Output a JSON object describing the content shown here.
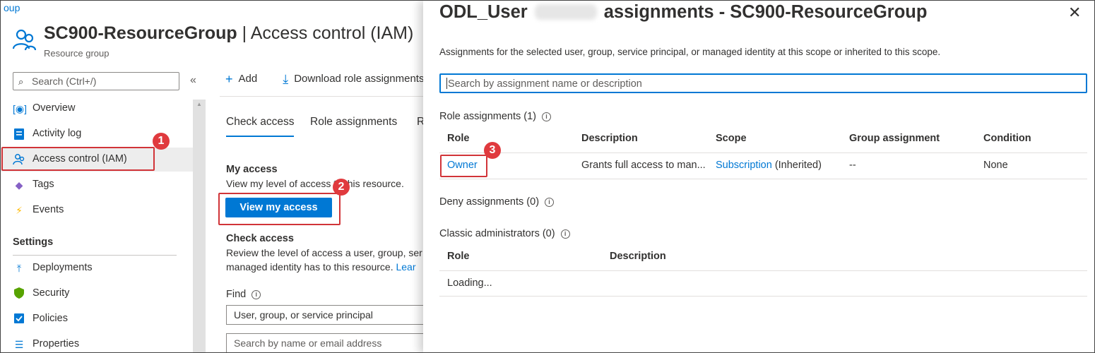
{
  "breadcrumb": {
    "tail": "oup"
  },
  "header": {
    "resource_name": "SC900-ResourceGroup",
    "separator": " | ",
    "page_name": "Access control (IAM)",
    "subtitle": "Resource group"
  },
  "sidebar": {
    "search_placeholder": "Search (Ctrl+/)",
    "collapse_glyph": "«",
    "items": [
      {
        "label": "Overview",
        "icon": "overview-icon"
      },
      {
        "label": "Activity log",
        "icon": "activity-log-icon"
      },
      {
        "label": "Access control (IAM)",
        "icon": "iam-people-icon"
      },
      {
        "label": "Tags",
        "icon": "tag-icon"
      },
      {
        "label": "Events",
        "icon": "lightning-icon"
      }
    ],
    "settings_label": "Settings",
    "settings_items": [
      {
        "label": "Deployments",
        "icon": "upload-icon"
      },
      {
        "label": "Security",
        "icon": "shield-icon"
      },
      {
        "label": "Policies",
        "icon": "policy-icon"
      },
      {
        "label": "Properties",
        "icon": "properties-icon"
      }
    ]
  },
  "toolbar": {
    "add_label": "Add",
    "download_label": "Download role assignments"
  },
  "tabs": [
    "Check access",
    "Role assignments",
    "R"
  ],
  "my_access": {
    "heading": "My access",
    "description": "View my level of access to this resource.",
    "button_label": "View my access"
  },
  "check_access": {
    "heading": "Check access",
    "line1": "Review the level of access a user, group, ser",
    "line2": "managed identity has to this resource.",
    "learn_more": "Lear"
  },
  "find": {
    "label": "Find",
    "info_glyph": "i",
    "dropdown_value": "User, group, or service principal",
    "search_placeholder": "Search by name or email address"
  },
  "markers": [
    "1",
    "2",
    "3"
  ],
  "panel": {
    "title_prefix": "ODL_User",
    "title_suffix": "assignments - SC900-ResourceGroup",
    "close_glyph": "✕",
    "description": "Assignments for the selected user, group, service principal, or managed identity at this scope or inherited to this scope.",
    "search_placeholder": "Search by assignment name or description",
    "role_assignments": {
      "title": "Role assignments (1)",
      "columns": [
        "Role",
        "Description",
        "Scope",
        "Group assignment",
        "Condition"
      ],
      "rows": [
        {
          "role": "Owner",
          "description": "Grants full access to man...",
          "scope_link": "Subscription",
          "scope_suffix": " (Inherited)",
          "group_assignment": "--",
          "condition": "None"
        }
      ]
    },
    "deny_assignments": {
      "title": "Deny assignments (0)"
    },
    "classic_admins": {
      "title": "Classic administrators (0)",
      "columns": [
        "Role",
        "Description"
      ],
      "loading": "Loading..."
    }
  },
  "colors": {
    "accent": "#0078d4",
    "highlight_red": "#d13438",
    "marker_red": "#e03a3e"
  }
}
